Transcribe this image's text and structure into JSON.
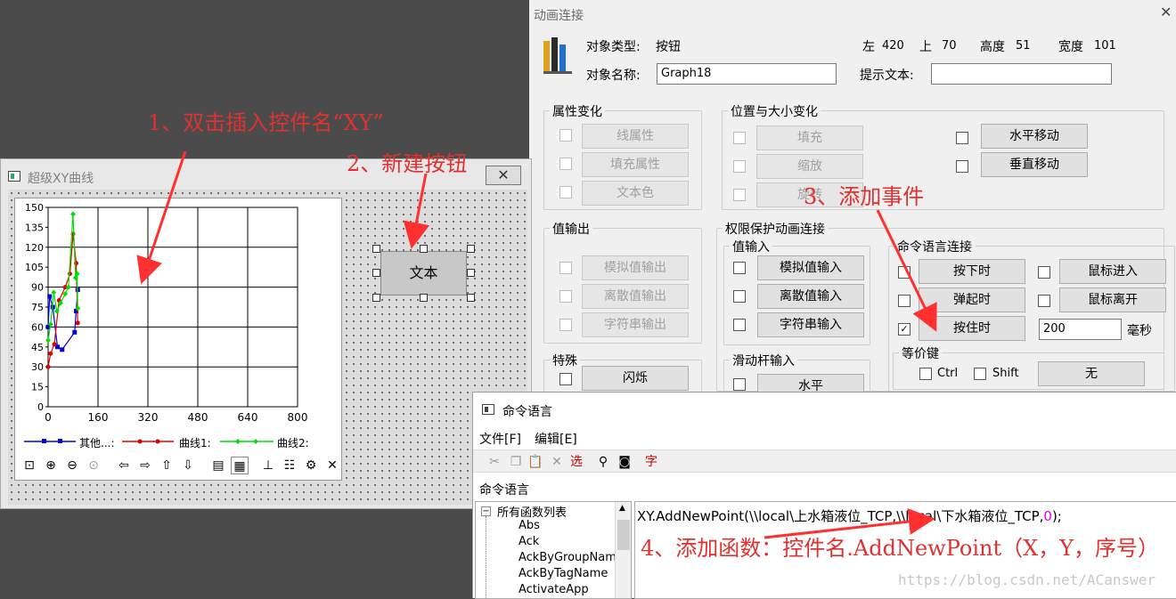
{
  "dialog": {
    "title": "动画连接",
    "object_type_label": "对象类型:",
    "object_type": "按钮",
    "object_name_label": "对象名称:",
    "object_name": "Graph18",
    "left_label": "左",
    "left": "420",
    "top_label": "上",
    "top": "70",
    "height_label": "高度",
    "height": "51",
    "width_label": "宽度",
    "width": "101",
    "tip_label": "提示文本:",
    "tip": "",
    "attr_group": "属性变化",
    "attr_buttons": [
      "线属性",
      "填充属性",
      "文本色"
    ],
    "pos_group": "位置与大小变化",
    "pos_buttons": [
      "填充",
      "缩放",
      "旋转"
    ],
    "move_buttons": [
      "水平移动",
      "垂直移动"
    ],
    "value_out_group": "值输出",
    "value_out_buttons": [
      "模拟值输出",
      "离散值输出",
      "字符串输出"
    ],
    "perm_group": "权限保护动画连接",
    "value_in_group": "值输入",
    "value_in_buttons": [
      "模拟值输入",
      "离散值输入",
      "字符串输入"
    ],
    "cmd_group": "命令语言连接",
    "cmd_left": [
      "按下时",
      "弹起时",
      "按住时"
    ],
    "cmd_right": [
      "鼠标进入",
      "鼠标离开"
    ],
    "hold_ms": "200",
    "ms_label": "毫秒",
    "equiv_group": "等价键",
    "ctrl": "Ctrl",
    "shift": "Shift",
    "none_btn": "无",
    "special_group": "特殊",
    "flash": "闪烁",
    "slider_group": "滑动杆输入",
    "horizontal": "水平"
  },
  "xy_window": {
    "title": "超级XY曲线",
    "chart_data": {
      "type": "line",
      "xlim": [
        0,
        800
      ],
      "ylim": [
        0,
        150
      ],
      "x_ticks": [
        "0",
        "160",
        "320",
        "480",
        "640",
        "800"
      ],
      "y_ticks": [
        "0",
        "15",
        "30",
        "45",
        "60",
        "75",
        "90",
        "105",
        "120",
        "135",
        "150"
      ],
      "series": [
        {
          "name": "其他...:",
          "color": "#0000e0",
          "points": [
            [
              0,
              60
            ],
            [
              5,
              83
            ],
            [
              15,
              75
            ],
            [
              30,
              45
            ],
            [
              45,
              43
            ],
            [
              85,
              56
            ],
            [
              90,
              72
            ],
            [
              95,
              88
            ]
          ]
        },
        {
          "name": "曲线1:",
          "color": "#e00000",
          "points": [
            [
              0,
              30
            ],
            [
              8,
              40
            ],
            [
              20,
              47
            ],
            [
              35,
              80
            ],
            [
              55,
              90
            ],
            [
              70,
              100
            ],
            [
              80,
              130
            ],
            [
              90,
              108
            ],
            [
              95,
              63
            ]
          ]
        },
        {
          "name": "曲线2:",
          "color": "#00e000",
          "points": [
            [
              0,
              50
            ],
            [
              8,
              62
            ],
            [
              18,
              86
            ],
            [
              28,
              72
            ],
            [
              40,
              78
            ],
            [
              55,
              85
            ],
            [
              65,
              90
            ],
            [
              80,
              145
            ],
            [
              88,
              97
            ],
            [
              93,
              100
            ],
            [
              95,
              74
            ]
          ]
        }
      ]
    },
    "legend": [
      "其他...:",
      "曲线1:",
      "曲线2:"
    ],
    "button_text": "文本"
  },
  "cmd_window": {
    "title": "命令语言",
    "menu": [
      "文件[F]",
      "编辑[E]"
    ],
    "toolbar_text_1": "选",
    "toolbar_text_2": "字",
    "label": "命令语言",
    "tree_root": "所有函数列表",
    "tree_items": [
      "Abs",
      "Ack",
      "AckByGroupName",
      "AckByTagName",
      "ActivateApp"
    ],
    "code_prefix": "XY.AddNewPoint(\\\\local\\上水箱液位_TCP,\\\\local\\下水箱液位_TCP,",
    "code_num": "0",
    "code_suffix": ");"
  },
  "annotations": [
    "1、双击插入控件名“XY”",
    "2、新建按钮",
    "3、添加事件",
    "4、添加函数：控件名.AddNewPoint（X，Y，序号）"
  ],
  "watermark": "https://blog.csdn.net/ACanswer"
}
